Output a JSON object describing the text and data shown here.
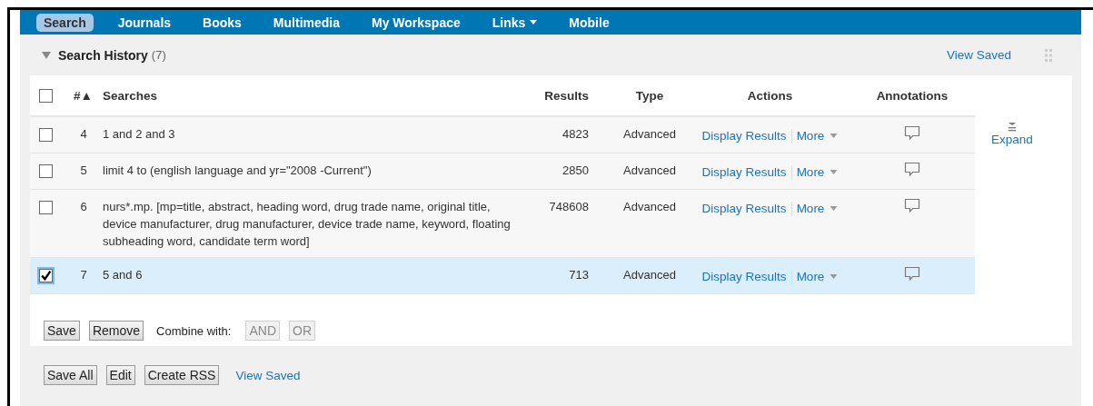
{
  "nav": {
    "tabs": [
      {
        "label": "Search",
        "selected": true,
        "has_menu": false
      },
      {
        "label": "Journals",
        "selected": false,
        "has_menu": false
      },
      {
        "label": "Books",
        "selected": false,
        "has_menu": false
      },
      {
        "label": "Multimedia",
        "selected": false,
        "has_menu": false
      },
      {
        "label": "My Workspace",
        "selected": false,
        "has_menu": false
      },
      {
        "label": "Links",
        "selected": false,
        "has_menu": true
      },
      {
        "label": "Mobile",
        "selected": false,
        "has_menu": false
      }
    ]
  },
  "panel": {
    "title": "Search History",
    "count": "(7)",
    "expanded": true,
    "view_saved": "View Saved"
  },
  "table": {
    "select_all_checked": false,
    "columns": [
      {
        "label": "#",
        "sort": "▲"
      },
      {
        "label": "Searches"
      },
      {
        "label": "Results"
      },
      {
        "label": "Type"
      },
      {
        "label": "Actions"
      },
      {
        "label": "Annotations"
      }
    ],
    "rows": [
      {
        "number": "4",
        "search": "1 and 2 and 3",
        "results": "4823",
        "type": "Advanced",
        "actions": [
          "Display Results",
          "More"
        ],
        "checked": false,
        "selected": false
      },
      {
        "number": "5",
        "search": "limit 4 to (english language and yr=\"2008 -Current\")",
        "results": "2850",
        "type": "Advanced",
        "actions": [
          "Display Results",
          "More"
        ],
        "checked": false,
        "selected": false
      },
      {
        "number": "6",
        "search": "nurs*.mp. [mp=title, abstract, heading word, drug trade name, original title, device manufacturer, drug manufacturer, device trade name, keyword, floating subheading word, candidate term word]",
        "results": "748608",
        "type": "Advanced",
        "actions": [
          "Display Results",
          "More"
        ],
        "checked": false,
        "selected": false
      },
      {
        "number": "7",
        "search": "5 and 6",
        "results": "713",
        "type": "Advanced",
        "actions": [
          "Display Results",
          "More"
        ],
        "checked": true,
        "selected": true
      }
    ],
    "expand": "Expand"
  },
  "row_buttons": [
    {
      "label": "Save",
      "disabled": false
    },
    {
      "label": "Remove",
      "disabled": false
    }
  ],
  "combine": {
    "label": "Combine with:",
    "buttons": [
      {
        "label": "AND",
        "disabled": true
      },
      {
        "label": "OR",
        "disabled": true
      }
    ]
  },
  "footer": {
    "buttons": [
      "Save All",
      "Edit",
      "Create RSS"
    ],
    "link": "View Saved"
  }
}
